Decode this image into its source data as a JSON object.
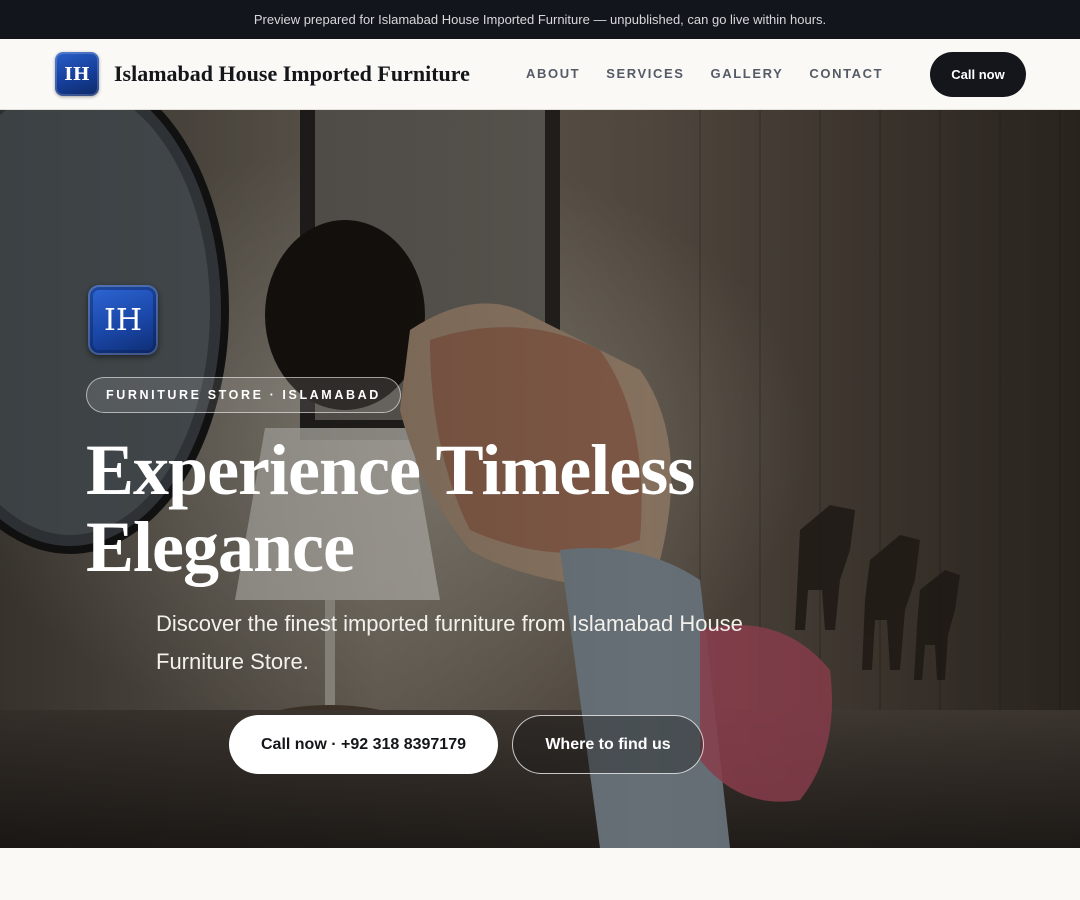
{
  "announcement": "Preview prepared for Islamabad House Imported Furniture — unpublished, can go live within hours.",
  "header": {
    "logo_initials": "IH",
    "brand_name": "Islamabad House Imported Furniture",
    "nav_links": [
      "ABOUT",
      "SERVICES",
      "GALLERY",
      "CONTACT"
    ],
    "cta_label": "Call now"
  },
  "hero": {
    "logo_initials": "IH",
    "eyebrow": "FURNITURE STORE · ISLAMABAD",
    "title_line1": "Experience Timeless",
    "title_line2": "Elegance",
    "subtitle": "Discover the finest imported furniture from Islamabad House Furniture Store.",
    "primary_button": "Call now · +92 318 8397179",
    "secondary_button": "Where to find us",
    "background_image": "woman-arranging-furniture-shop-photo"
  },
  "colors": {
    "topbar": "#12151b",
    "accent_blue": "#1a47a8",
    "dark_button": "#14161b",
    "page_background": "#faf9f6"
  }
}
